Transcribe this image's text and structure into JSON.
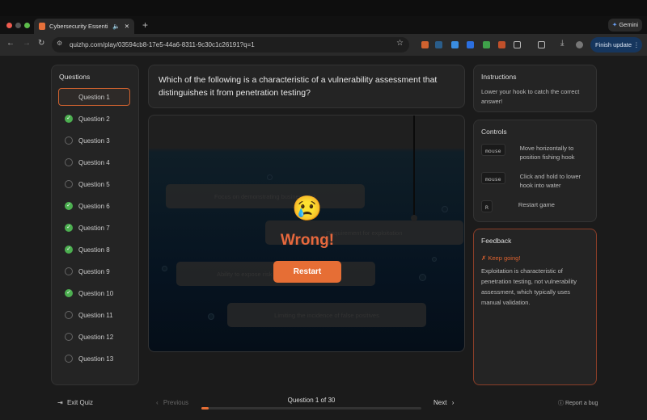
{
  "browser": {
    "tab_title": "Cybersecurity Essentials",
    "url": "quizhp.com/play/03594cb8-17e5-44a6-8311-9c30c1c26191?q=1",
    "finish_update": "Finish update",
    "gemini": "Gemini"
  },
  "sidebar": {
    "title": "Questions",
    "items": [
      {
        "label": "Question 1",
        "state": "current"
      },
      {
        "label": "Question 2",
        "state": "done"
      },
      {
        "label": "Question 3",
        "state": "todo"
      },
      {
        "label": "Question 4",
        "state": "todo"
      },
      {
        "label": "Question 5",
        "state": "todo"
      },
      {
        "label": "Question 6",
        "state": "done"
      },
      {
        "label": "Question 7",
        "state": "done"
      },
      {
        "label": "Question 8",
        "state": "done"
      },
      {
        "label": "Question 9",
        "state": "todo"
      },
      {
        "label": "Question 10",
        "state": "done"
      },
      {
        "label": "Question 11",
        "state": "todo"
      },
      {
        "label": "Question 12",
        "state": "todo"
      },
      {
        "label": "Question 13",
        "state": "todo"
      }
    ]
  },
  "question": "Which of the following is a characteristic of a vulnerability assessment that distinguishes it from penetration testing?",
  "game": {
    "answers": [
      "Focus on demonstrating business risk",
      "Requirement for exploitation",
      "Ability to expose risk",
      "Limiting the incidence of false positives"
    ],
    "emoji": "😢",
    "result": "Wrong!",
    "restart": "Restart"
  },
  "instructions": {
    "title": "Instructions",
    "text": "Lower your hook to catch the correct answer!"
  },
  "controls": {
    "title": "Controls",
    "items": [
      {
        "key": "mouse",
        "desc": "Move horizontally to position fishing hook"
      },
      {
        "key": "mouse",
        "desc": "Click and hold to lower hook into water"
      },
      {
        "key": "R",
        "desc": "Restart game"
      }
    ]
  },
  "feedback": {
    "title": "Feedback",
    "status": "✗ Keep going!",
    "text": "Exploitation is characteristic of penetration testing, not vulnerability assessment, which typically uses manual validation."
  },
  "footer": {
    "exit": "Exit Quiz",
    "previous": "Previous",
    "progress_label": "Question 1 of 30",
    "progress": 0.033,
    "next": "Next",
    "report": "Report a bug"
  },
  "colors": {
    "accent": "#e66e35",
    "success": "#4caf50"
  }
}
